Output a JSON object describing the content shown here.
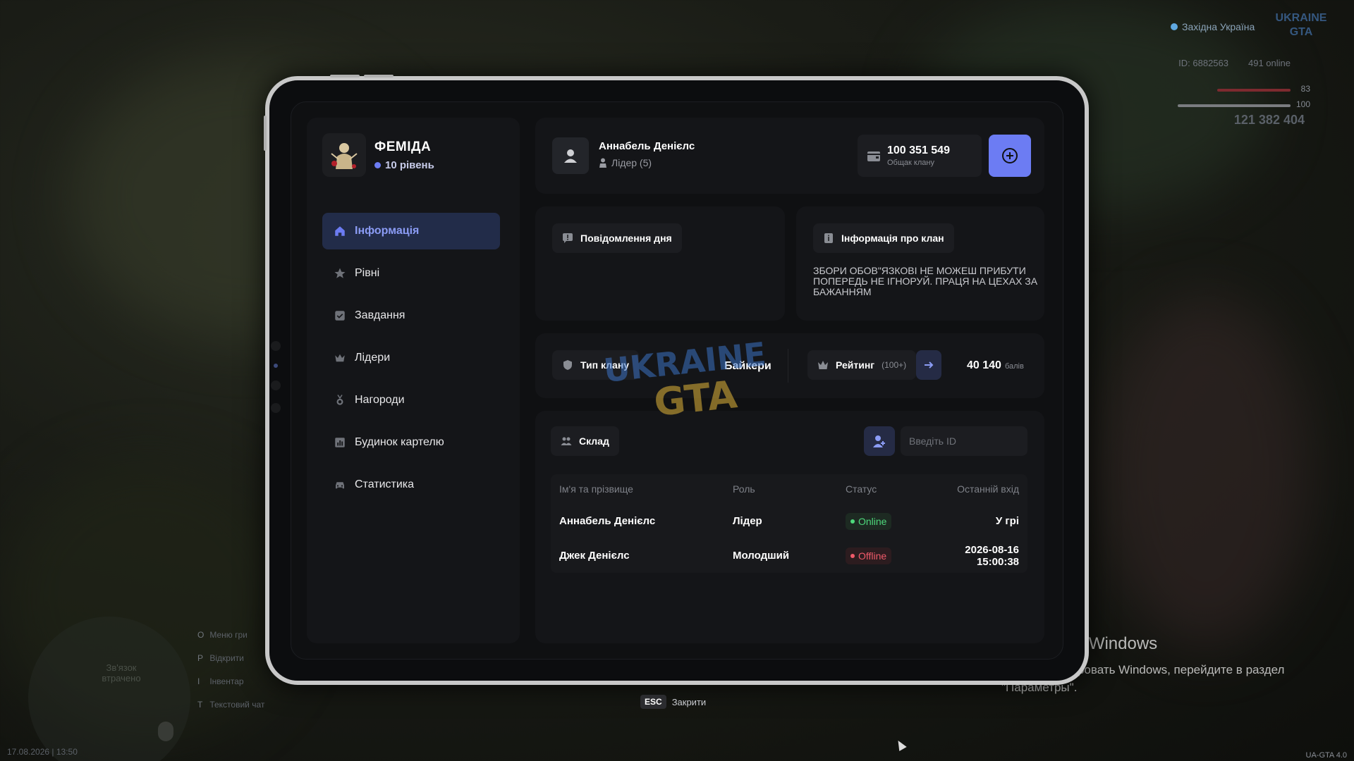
{
  "hud": {
    "region": "Західна Україна",
    "logo": "UKRAINE GTA",
    "player_id": "ID: 6882563",
    "online": "491 online",
    "health": "83",
    "armor": "100",
    "money": "121 382 404",
    "menu": [
      {
        "key": "O",
        "label": "Меню гри"
      },
      {
        "key": "P",
        "label": "Відкрити"
      },
      {
        "key": "I",
        "label": "Інвентар"
      },
      {
        "key": "T",
        "label": "Текстовий чат"
      }
    ],
    "map_label": "Зв'язок втрачено",
    "datetime": "17.08.2026 | 13:50",
    "version": "UA-GTA 4.0"
  },
  "windows_activation": {
    "title": "Активация Windows",
    "text": "Чтобы активировать Windows, перейдите в раздел \"Параметры\"."
  },
  "clan": {
    "name": "ФЕМІДА",
    "level": "10 рівень"
  },
  "nav": [
    {
      "label": "Інформація",
      "icon": "home-icon",
      "active": true
    },
    {
      "label": "Рівні",
      "icon": "star-icon",
      "active": false
    },
    {
      "label": "Завдання",
      "icon": "task-check-icon",
      "active": false
    },
    {
      "label": "Лідери",
      "icon": "crown-icon",
      "active": false
    },
    {
      "label": "Нагороди",
      "icon": "medal-icon",
      "active": false
    },
    {
      "label": "Будинок картелю",
      "icon": "bar-chart-icon",
      "active": false
    },
    {
      "label": "Статистика",
      "icon": "car-icon",
      "active": false
    }
  ],
  "user": {
    "name": "Аннабель Денієлс",
    "role": "Лідер (5)"
  },
  "balance": {
    "amount": "100 351 549",
    "label": "Общак клану"
  },
  "motd": {
    "title": "Повідомлення дня"
  },
  "clan_info": {
    "title": "Інформація про клан",
    "text": "ЗБОРИ ОБОВ\"ЯЗКОВІ НЕ МОЖЕШ ПРИБУТИ ПОПЕРЕДЬ НЕ ІГНОРУЙ. ПРАЦЯ НА ЦЕХАХ ЗА БАЖАННЯМ"
  },
  "clan_type": {
    "label": "Тип клану",
    "value": "Байкери"
  },
  "rating": {
    "label": "Рейтинг",
    "sub": "(100+)",
    "score": "40 140",
    "unit": "балів"
  },
  "roster": {
    "title": "Склад",
    "input_placeholder": "Введіть ID",
    "columns": [
      "Ім'я та прізвище",
      "Роль",
      "Статус",
      "Останній вхід"
    ],
    "rows": [
      {
        "name": "Аннабель Денієлс",
        "role": "Лідер",
        "status": "Online",
        "last": "У грі"
      },
      {
        "name": "Джек Денієлс",
        "role": "Молодший",
        "status": "Offline",
        "last": "2026-08-16 15:00:38"
      }
    ]
  },
  "footer": {
    "esc_key": "ESC",
    "esc_label": "Закрити"
  },
  "colors": {
    "accent": "#6c7cf3",
    "online": "#4ed87c",
    "offline": "#ef5a6a"
  }
}
